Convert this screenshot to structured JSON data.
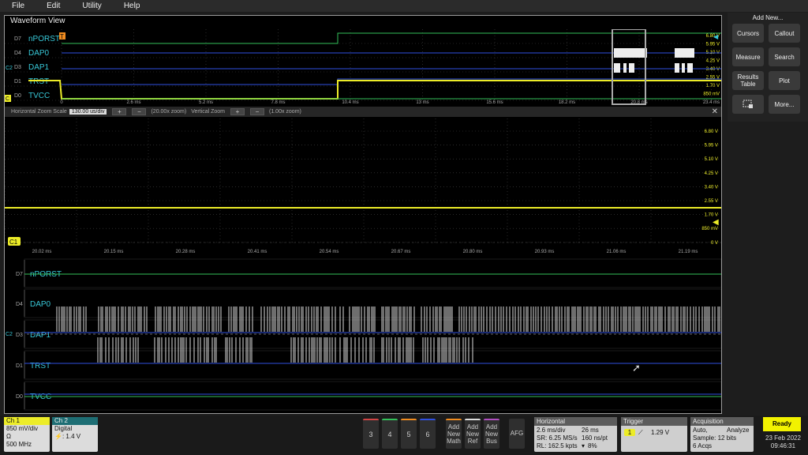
{
  "menu": [
    "File",
    "Edit",
    "Utility",
    "Help"
  ],
  "waveform_view": {
    "title": "Waveform View"
  },
  "overview": {
    "channels": [
      {
        "tag": "D7",
        "name": "nPORST"
      },
      {
        "tag": "D4",
        "name": "DAP0"
      },
      {
        "tag": "D3",
        "name": "DAP1"
      },
      {
        "tag": "D1",
        "name": "TRST"
      },
      {
        "tag": "D0",
        "name": "TVCC"
      }
    ],
    "time_ticks": [
      "0",
      "2.6 ms",
      "5.2 ms",
      "7.8 ms",
      "10.4 ms",
      "13 ms",
      "15.6 ms",
      "18.2 ms",
      "20.8 ms",
      "23.4 ms"
    ],
    "volt_ticks": [
      "6.80 V",
      "5.95 V",
      "5.10 V",
      "4.25 V",
      "3.40 V",
      "2.55 V",
      "1.70 V",
      "850 mV"
    ],
    "trigger_marker": "T",
    "c2_marker": "C2",
    "c1_marker": "C"
  },
  "zoom_bar": {
    "h_label": "Horizontal Zoom Scale",
    "h_value": "130.00 us/div",
    "h_zoom": "(20.00x zoom)",
    "v_label": "Vertical Zoom",
    "v_zoom": "(1.00x zoom)",
    "close": "✕"
  },
  "analog": {
    "volt_ticks": [
      "6.80 V",
      "5.95 V",
      "5.10 V",
      "4.25 V",
      "3.40 V",
      "2.55 V",
      "1.70 V",
      "850 mV",
      "0 V"
    ],
    "time_ticks": [
      "20.02 ms",
      "20.15 ms",
      "20.28 ms",
      "20.41 ms",
      "20.54 ms",
      "20.67 ms",
      "20.80 ms",
      "20.93 ms",
      "21.06 ms",
      "21.19 ms"
    ],
    "ch_label": "C1"
  },
  "digital": {
    "channels": [
      {
        "tag": "D7",
        "name": "nPORST"
      },
      {
        "tag": "D4",
        "name": "DAP0"
      },
      {
        "tag": "D3",
        "name": "DAP1"
      },
      {
        "tag": "D1",
        "name": "TRST"
      },
      {
        "tag": "D0",
        "name": "TVCC"
      }
    ],
    "c2_marker": "C2"
  },
  "side_panel": {
    "title": "Add New...",
    "buttons": [
      "Cursors",
      "Callout",
      "Measure",
      "Search",
      "Results Table",
      "Plot",
      "",
      "More..."
    ]
  },
  "bottom": {
    "ch1": {
      "label": "Ch 1",
      "scale": "850 mV/div",
      "coupling": "Ω",
      "bandwidth": "500 MHz"
    },
    "ch2": {
      "label": "Ch 2",
      "type": "Digital",
      "threshold": "⚡: 1.4 V"
    },
    "num_buttons": [
      "3",
      "4",
      "5",
      "6"
    ],
    "add_buttons": [
      "Add New Math",
      "Add New Ref",
      "Add New Bus"
    ],
    "afg": "AFG",
    "horizontal": {
      "title": "Horizontal",
      "l1a": "2.6 ms/div",
      "l1b": "26 ms",
      "l2a": "SR: 6.25 MS/s",
      "l2b": "160 ns/pt",
      "l3a": "RL: 162.5 kpts",
      "l3b": "8%"
    },
    "trigger": {
      "title": "Trigger",
      "source": "1",
      "level": "1.29 V"
    },
    "acquisition": {
      "title": "Acquisition",
      "l1": "Auto,",
      "l1b": "Analyze",
      "l2": "Sample: 12 bits",
      "l3": "6 Acqs"
    },
    "status": "Ready",
    "date": "23 Feb 2022",
    "time": "09:46:31"
  },
  "colors": {
    "teal": "#38c8d8",
    "yellow": "#ecec28",
    "blue": "#3050e0",
    "green": "#33c05a",
    "orange": "#f08c20"
  }
}
